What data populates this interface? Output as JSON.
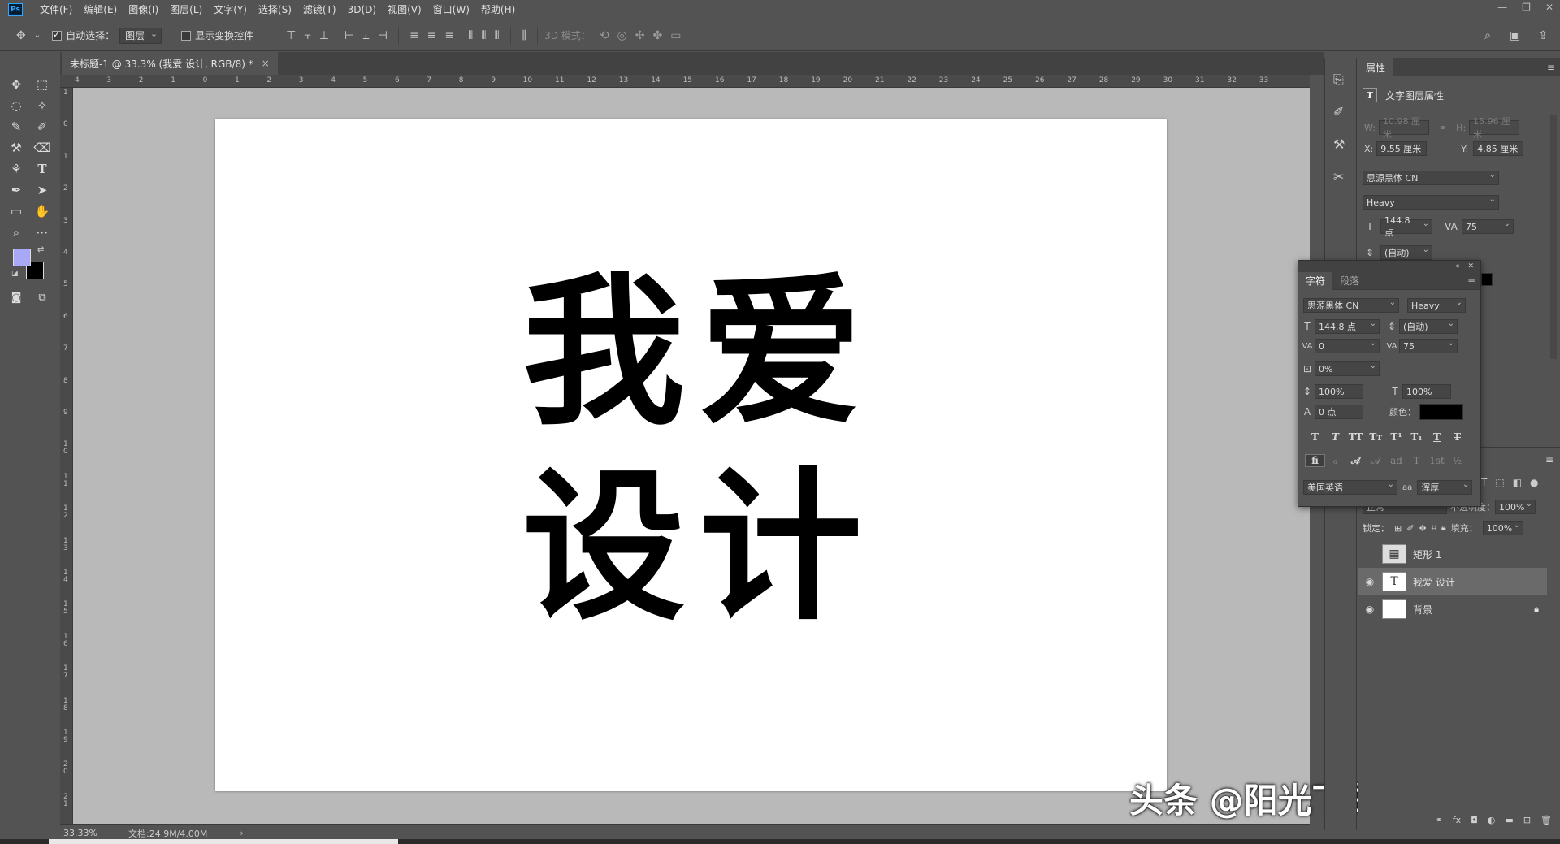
{
  "menu": {
    "logo": "Ps",
    "items": [
      "文件(F)",
      "编辑(E)",
      "图像(I)",
      "图层(L)",
      "文字(Y)",
      "选择(S)",
      "滤镜(T)",
      "3D(D)",
      "视图(V)",
      "窗口(W)",
      "帮助(H)"
    ]
  },
  "options": {
    "auto_select_label": "自动选择：",
    "auto_select_value": "图层",
    "show_transform_label": "显示变换控件",
    "mode_3d_label": "3D 模式："
  },
  "document": {
    "tab_title": "未标题-1 @ 33.3% (我爱 设计, RGB/8) *",
    "line1": "我爱",
    "line2": "设计"
  },
  "rulers": {
    "top": [
      "4",
      "3",
      "2",
      "1",
      "0",
      "1",
      "2",
      "3",
      "4",
      "5",
      "6",
      "7",
      "8",
      "9",
      "10",
      "11",
      "12",
      "13",
      "14",
      "15",
      "16",
      "17",
      "18",
      "19",
      "20",
      "21",
      "22",
      "23",
      "24",
      "25",
      "26",
      "27",
      "28",
      "29",
      "30",
      "31",
      "32",
      "33"
    ],
    "left": [
      "1",
      "0",
      "1",
      "2",
      "3",
      "4",
      "5",
      "6",
      "7",
      "8",
      "9",
      "1 0",
      "1 1",
      "1 2",
      "1 3",
      "1 4",
      "1 5",
      "1 6",
      "1 7",
      "1 8",
      "1 9",
      "2 0",
      "2 1"
    ]
  },
  "status": {
    "zoom": "33.33%",
    "doc_info": "文档:24.9M/4.00M"
  },
  "watermark": "头条 @阳光下的奔跑者",
  "properties": {
    "tab": "属性",
    "section_title": "文字图层属性",
    "w_label": "W:",
    "w_value": "10.98 厘米",
    "h_label": "H:",
    "h_value": "15.96 厘米",
    "x_label": "X:",
    "x_value": "9.55 厘米",
    "y_label": "Y:",
    "y_value": "4.85 厘米",
    "font_family": "思源黑体 CN",
    "font_style": "Heavy",
    "size": "144.8 点",
    "tracking": "75",
    "leading": "(自动)"
  },
  "character": {
    "tab_active": "字符",
    "tab_other": "段落",
    "font_family": "思源黑体 CN",
    "font_style": "Heavy",
    "size": "144.8 点",
    "leading": "(自动)",
    "kerning": "0",
    "tracking": "75",
    "scale_pct": "0%",
    "vscale": "100%",
    "hscale": "100%",
    "baseline": "0 点",
    "color_label": "颜色：",
    "color": "#000000",
    "language": "美国英语",
    "aa_label": "aa",
    "antialias": "浑厚"
  },
  "layers": {
    "blend_mode": "正常",
    "opacity_label": "不透明度：",
    "opacity": "100%",
    "lock_label": "锁定：",
    "fill_label": "填充：",
    "fill": "100%",
    "items": [
      {
        "name": "矩形 1",
        "visible": false,
        "type": "shape"
      },
      {
        "name": "我爱 设计",
        "visible": true,
        "type": "text",
        "selected": true
      },
      {
        "name": "背景",
        "visible": true,
        "type": "background",
        "locked": true
      }
    ]
  },
  "colors": {
    "foreground": "#a9a8f6",
    "background": "#000000"
  }
}
